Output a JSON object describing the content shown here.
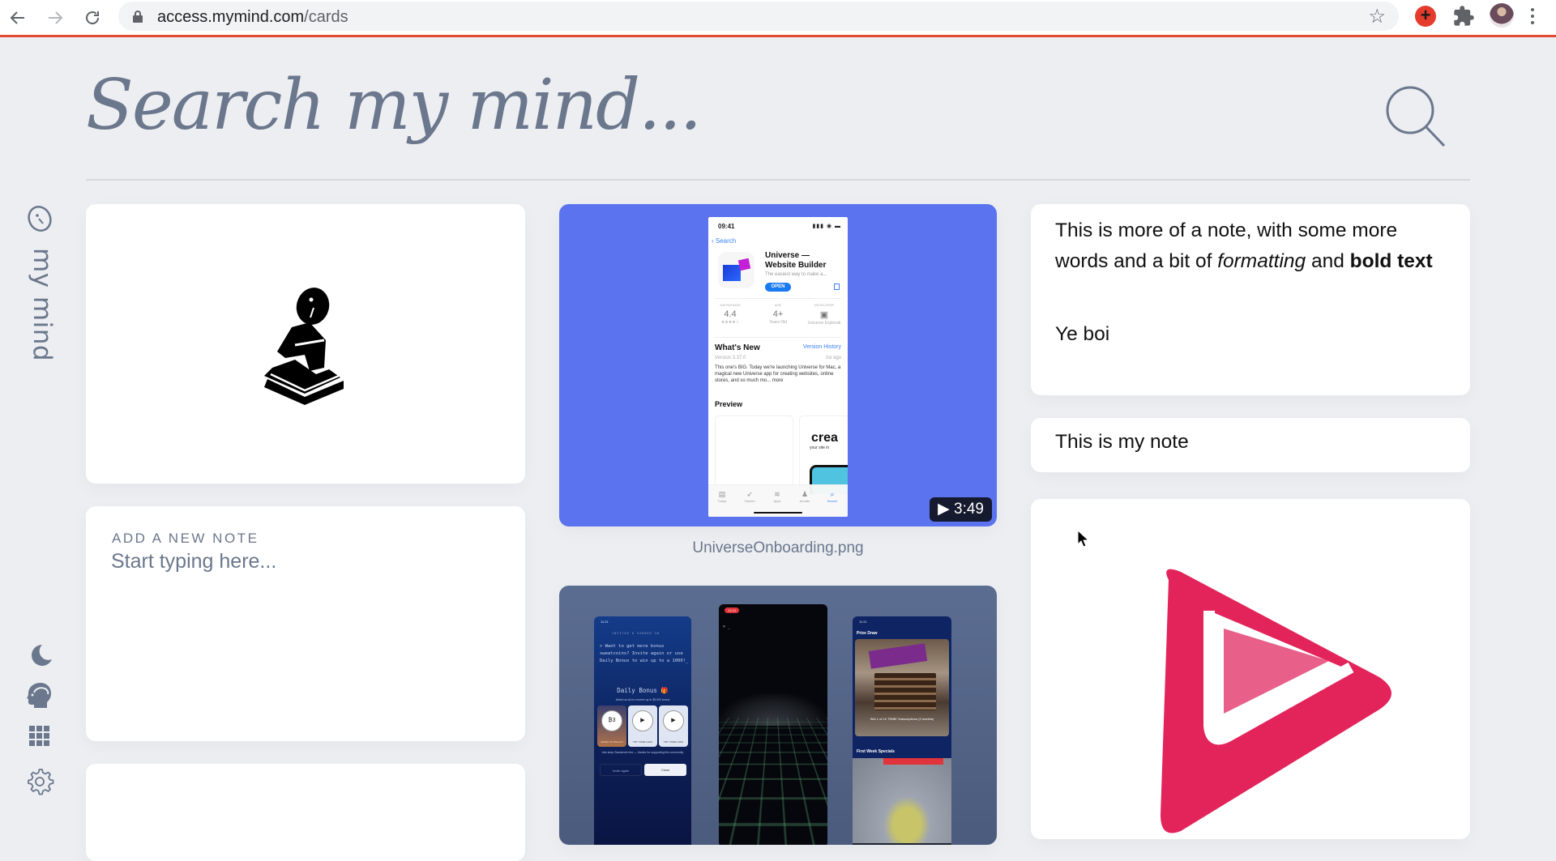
{
  "browser": {
    "url_host": "access.mymind.com",
    "url_path": "/cards",
    "colors": {
      "accent_line": "#e34a33",
      "extension": "#e43b2c"
    }
  },
  "sidebar": {
    "brand": "my mind",
    "icons": [
      "moon-icon",
      "brain-icon",
      "grid-icon",
      "gear-icon"
    ]
  },
  "search": {
    "placeholder": "Search my mind..."
  },
  "cards": {
    "add_note": {
      "label": "ADD A NEW NOTE",
      "placeholder": "Start typing here..."
    },
    "video": {
      "duration": "▶ 3:49",
      "caption": "UniverseOnboarding.png",
      "bg_color": "#5b73ef",
      "app": {
        "time": "09:41",
        "back": "Search",
        "name": "Universe — Website Builder",
        "subtitle": "The easiest way to make a...",
        "open": "OPEN",
        "ratings_label": "549 RATINGS",
        "rating": "4.4",
        "stars": "★★★★☆",
        "age_label": "AGE",
        "age": "4+",
        "age_sub": "Years Old",
        "dev_label": "DEVELOPER",
        "dev_sub": "Universe Explorati",
        "whats_new": "What's New",
        "version_history": "Version History",
        "version": "Version 3.37.0",
        "ago": "1w ago",
        "description": "This one's BIG. Today we're launching Universe for Mac, a magical new Universe app for creating websites, online stores, and so much mo... more",
        "preview": "Preview",
        "crea": "crea",
        "crea_sub": "your site in",
        "tabs": [
          "Today",
          "Games",
          "Apps",
          "Arcade",
          "Search"
        ]
      }
    },
    "screens": {
      "s1": {
        "time": "11:21",
        "tabs": "INVITED 8     EARNED 38",
        "message": "> Want to get more bonus sweatcoins? Invite again or use Daily Bonus to win up to a 1000!_",
        "bonus": "Daily Bonus 🎁",
        "bonus_sub": "Watch an Ad to receive up to ₿1000 bonus",
        "tile_value": "₿3",
        "tile_labels": [
          "ADDED TO WALLET",
          "TRY YOUR LUCK",
          "TRY YOUR LUCK"
        ],
        "footer": "Ads keep Sweatcoin free — thanks for supporting the community",
        "invite": "Invite again",
        "close": "Close"
      },
      "s2": {
        "time": "11:14",
        "prompt": "> _"
      },
      "s3": {
        "time": "11:21",
        "title": "Prize Draw",
        "caption": "Win 1 of 10 TRIBE Subscriptions (3 months)",
        "specials": "First Week Specials"
      }
    },
    "note1": {
      "line_plain": "This is more of a note, with some more words and a bit of ",
      "line_italic": "formatting",
      "line_and": " and ",
      "line_bold": "bold text",
      "second_paragraph": "Ye boi"
    },
    "note2": {
      "text": "This is my note"
    },
    "play_logo": {
      "primary": "#e2245a",
      "secondary": "#e8608a"
    }
  }
}
